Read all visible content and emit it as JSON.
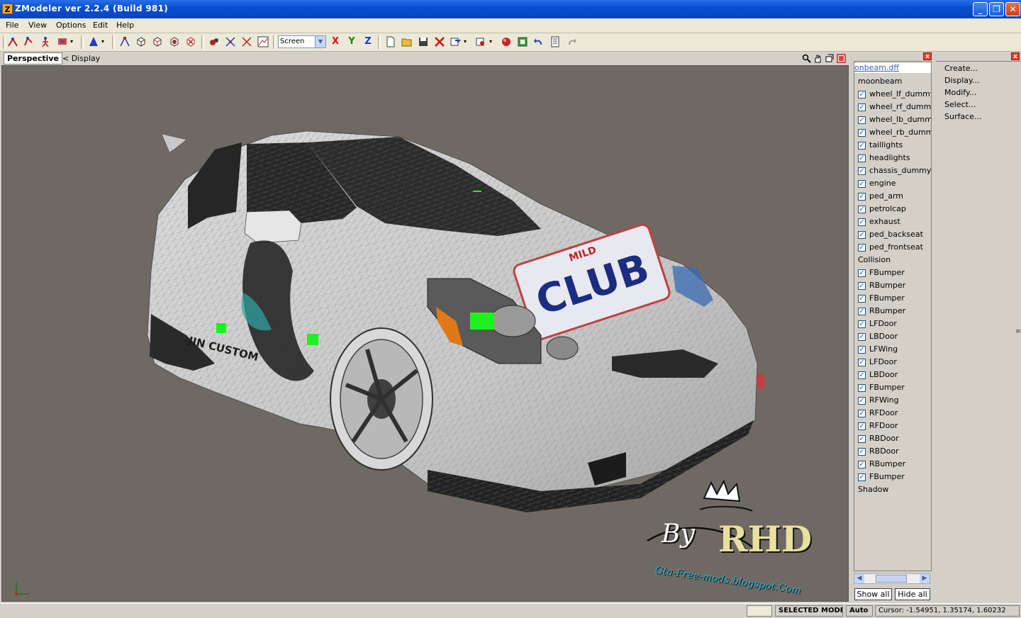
{
  "window": {
    "app_icon_letter": "Z",
    "title": "ZModeler ver 2.2.4 (Build 981)",
    "minimize": "_",
    "maximize": "❐",
    "close": "✕"
  },
  "menu": [
    "File",
    "View",
    "Options",
    "Edit",
    "Help"
  ],
  "toolbar": {
    "mode_select": "Screen",
    "axes": [
      "X",
      "Y",
      "Z"
    ],
    "axis_colors": [
      "#e01010",
      "#109010",
      "#1040d0"
    ]
  },
  "viewport": {
    "tab": "Perspective",
    "breadcrumb": "<  Display",
    "background": "#6f6963"
  },
  "watermark": {
    "by": "By",
    "name": "RHD",
    "site": "Gta-Free-mods.blogspot.Com"
  },
  "car_graphics": {
    "hood_decal": "CLUB",
    "hood_decal_top": "MILD",
    "side_decal": "JIN CUSTOM"
  },
  "scene_tree": {
    "file": "moonbeam.dff",
    "file_visible": "onbeam.dff",
    "root": "moonbeam",
    "items": [
      {
        "label": "wheel_lf_dummy",
        "checked": true
      },
      {
        "label": "wheel_rf_dummy",
        "checked": true
      },
      {
        "label": "wheel_lb_dummy",
        "checked": true
      },
      {
        "label": "wheel_rb_dummy",
        "checked": true
      },
      {
        "label": "taillights",
        "checked": true
      },
      {
        "label": "headlights",
        "checked": true
      },
      {
        "label": "chassis_dummy",
        "checked": true
      },
      {
        "label": "engine",
        "checked": true
      },
      {
        "label": "ped_arm",
        "checked": true
      },
      {
        "label": "petrolcap",
        "checked": true
      },
      {
        "label": "exhaust",
        "checked": true
      },
      {
        "label": "ped_backseat",
        "checked": true
      },
      {
        "label": "ped_frontseat",
        "checked": true
      },
      {
        "label": "Collision",
        "group": true
      },
      {
        "label": "FBumper",
        "checked": true
      },
      {
        "label": "RBumper",
        "checked": true
      },
      {
        "label": "FBumper",
        "checked": true
      },
      {
        "label": "RBumper",
        "checked": true
      },
      {
        "label": "LFDoor",
        "checked": true
      },
      {
        "label": "LBDoor",
        "checked": true
      },
      {
        "label": "LFWing",
        "checked": true
      },
      {
        "label": "LFDoor",
        "checked": true
      },
      {
        "label": "LBDoor",
        "checked": true
      },
      {
        "label": "FBumper",
        "checked": true
      },
      {
        "label": "RFWing",
        "checked": true
      },
      {
        "label": "RFDoor",
        "checked": true
      },
      {
        "label": "RFDoor",
        "checked": true
      },
      {
        "label": "RBDoor",
        "checked": true
      },
      {
        "label": "RBDoor",
        "checked": true
      },
      {
        "label": "RBumper",
        "checked": true
      },
      {
        "label": "FBumper",
        "checked": true
      },
      {
        "label": "Shadow",
        "group": true
      }
    ],
    "show_all": "Show all",
    "hide_all": "Hide all"
  },
  "command_panel": {
    "items": [
      "Create...",
      "Display...",
      "Modify...",
      "Select...",
      "Surface..."
    ]
  },
  "status": {
    "mode": "SELECTED MODE",
    "snap": "Auto",
    "cursor": "Cursor: -1.54951, 1.35174, 1.60232"
  }
}
